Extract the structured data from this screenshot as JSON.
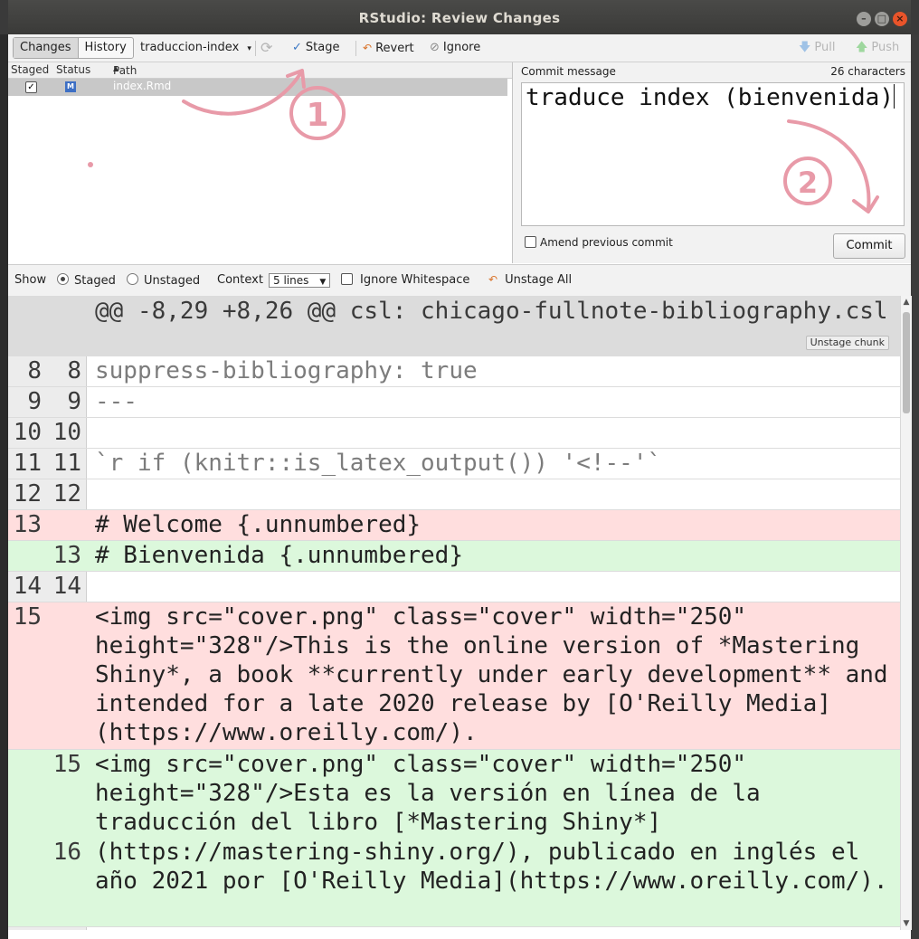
{
  "window": {
    "title": "RStudio: Review Changes"
  },
  "toolbar": {
    "tab_changes": "Changes",
    "tab_history": "History",
    "branch": "traduccion-index",
    "stage": "Stage",
    "revert": "Revert",
    "ignore": "Ignore",
    "pull": "Pull",
    "push": "Push"
  },
  "files": {
    "col_staged": "Staged",
    "col_status": "Status",
    "col_path": "Path",
    "rows": [
      {
        "staged": true,
        "status": "M",
        "path": "index.Rmd"
      }
    ]
  },
  "commit": {
    "label": "Commit message",
    "count": "26 characters",
    "message": "traduce index (bienvenida)",
    "amend_label": "Amend previous commit",
    "button": "Commit"
  },
  "diffbar": {
    "show": "Show",
    "staged": "Staged",
    "unstaged": "Unstaged",
    "context": "Context",
    "context_value": "5 lines",
    "ignore_ws": "Ignore Whitespace",
    "unstage_all": "Unstage All"
  },
  "diff": {
    "hunk": "@@ -8,29 +8,26 @@ csl: chicago-fullnote-bibliography.csl",
    "unstage_chunk": "Unstage chunk",
    "lines": [
      {
        "old": "8",
        "new": "8",
        "text": "suppress-bibliography: true"
      },
      {
        "old": "9",
        "new": "9",
        "text": "---"
      },
      {
        "old": "10",
        "new": "10",
        "text": ""
      },
      {
        "old": "11",
        "new": "11",
        "text": "`r if (knitr::is_latex_output()) '<!--'`"
      },
      {
        "old": "12",
        "new": "12",
        "text": ""
      },
      {
        "old": "13",
        "new": "",
        "text": "# Welcome {.unnumbered}"
      },
      {
        "old": "",
        "new": "13",
        "text": "# Bienvenida {.unnumbered}"
      },
      {
        "old": "14",
        "new": "14",
        "text": ""
      },
      {
        "old": "15",
        "new": "",
        "text": "<img src=\"cover.png\" class=\"cover\" width=\"250\" height=\"328\"/>This is the online version of *Mastering Shiny*, a book **currently under early development** and intended for a late 2020 release by [O'Reilly Media](https://www.oreilly.com/)."
      },
      {
        "old": "",
        "new": "15",
        "text": "<img src=\"cover.png\" class=\"cover\" width=\"250\" height=\"328\"/>Esta es la versión en línea de la traducción del libro [*Mastering Shiny*]"
      },
      {
        "old": "",
        "new": "16",
        "text": "(https://mastering-shiny.org/), publicado en inglés el año 2021 por [O'Reilly Media](https://www.oreilly.com/)."
      }
    ]
  },
  "annotations": [
    "1",
    "2"
  ]
}
